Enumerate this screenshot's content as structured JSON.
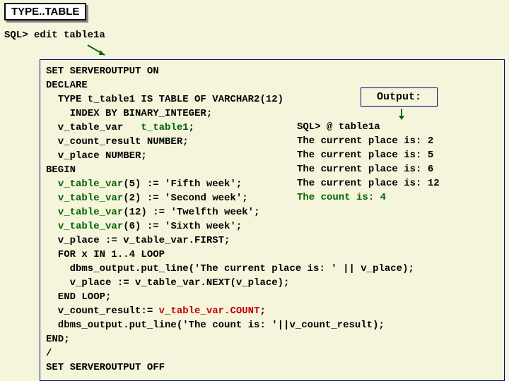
{
  "header": {
    "type_label": "TYPE..TABLE"
  },
  "sql": {
    "prompt": "SQL> edit ",
    "filename": "table1a"
  },
  "output_label": "Output:",
  "code": {
    "l01": "SET SERVEROUTPUT ON",
    "l02": "DECLARE",
    "l03": "  TYPE t_table1 IS TABLE OF VARCHAR2(12)",
    "l04": "    INDEX BY BINARY_INTEGER;",
    "l05a": "  v_table_var   ",
    "l05b": "t_table1",
    "l05c": ";",
    "l06": "  v_count_result NUMBER;",
    "l07": "  v_place NUMBER;",
    "l08": "BEGIN",
    "l09a": "  ",
    "l09b": "v_table_var",
    "l09c": "(5) := 'Fifth week';",
    "l10a": "  ",
    "l10b": "v_table_var",
    "l10c": "(2) := 'Second week';",
    "l11a": "  ",
    "l11b": "v_table_var",
    "l11c": "(12) := 'Twelfth week';",
    "l12a": "  ",
    "l12b": "v_table_var",
    "l12c": "(6) := 'Sixth week';",
    "l13": "  v_place := v_table_var.FIRST;",
    "l14": "  FOR x IN 1..4 LOOP",
    "l15": "    dbms_output.put_line('The current place is: ' || v_place);",
    "l16": "    v_place := v_table_var.NEXT(v_place);",
    "l17": "  END LOOP;",
    "l18a": "  v_count_result:= ",
    "l18b": "v_table_var.COUNT",
    "l18c": ";",
    "l19": "  dbms_output.put_line('The count is: '||v_count_result);",
    "l20": "END;",
    "l21": "/",
    "l22": "SET SERVEROUTPUT OFF"
  },
  "output": {
    "o1": "SQL> @ table1a",
    "o2": "The current place is: 2",
    "o3": "The current place is: 5",
    "o4": "The current place is: 6",
    "o5": "The current place is: 12",
    "o6": "The count is: 4"
  }
}
